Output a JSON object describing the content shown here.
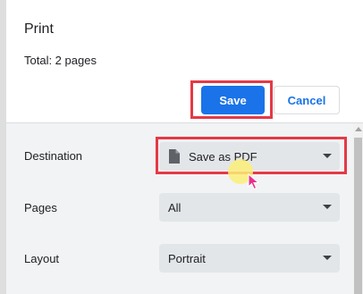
{
  "dialog": {
    "title": "Print",
    "summary": "Total: 2 pages"
  },
  "buttons": {
    "save_label": "Save",
    "cancel_label": "Cancel"
  },
  "settings": {
    "destination": {
      "label": "Destination",
      "value": "Save as PDF",
      "icon": "file-icon"
    },
    "pages": {
      "label": "Pages",
      "value": "All"
    },
    "layout": {
      "label": "Layout",
      "value": "Portrait"
    }
  },
  "colors": {
    "primary": "#1a73e8",
    "highlight": "#e53946",
    "settings_background": "#f1f3f4",
    "select_background": "#e3e6e8",
    "cursor": "#e8308b"
  }
}
